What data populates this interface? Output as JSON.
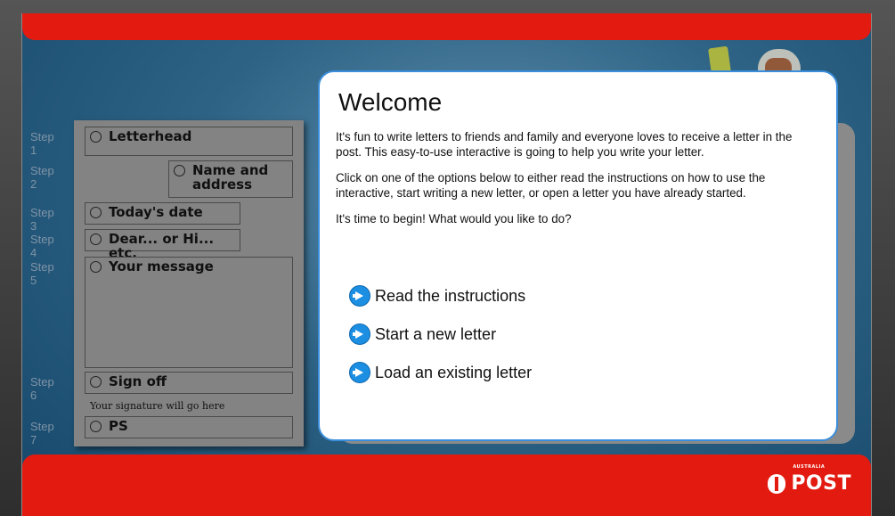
{
  "steps": [
    {
      "label": "Step 1",
      "field": "Letterhead"
    },
    {
      "label": "Step 2",
      "field_line1": "Name and",
      "field_line2": "address"
    },
    {
      "label": "Step 3",
      "field": "Today's date"
    },
    {
      "label": "Step 4",
      "field": "Dear... or Hi... etc."
    },
    {
      "label": "Step 5",
      "field": "Your message"
    },
    {
      "label": "Step 6",
      "field": "Sign off"
    },
    {
      "label": "Step 7",
      "field": "PS"
    }
  ],
  "signature_hint": "Your signature will go here",
  "modal": {
    "title": "Welcome",
    "paragraph1": "It's fun to write letters to friends and family and everyone loves to receive a letter in the post. This easy-to-use interactive is going to help you write your letter.",
    "paragraph2": "Click on one of the options below to either read the instructions on how to use the interactive, start writing a new letter, or open a letter you have already started.",
    "paragraph3": "It's time to begin! What would you like to do?",
    "options": [
      {
        "label": "Read the instructions",
        "icon": "arrow-right-icon"
      },
      {
        "label": "Start a new letter",
        "icon": "arrow-right-icon"
      },
      {
        "label": "Load an existing letter",
        "icon": "arrow-right-icon"
      }
    ]
  },
  "logo": {
    "small": "AUSTRALIA",
    "main": "POST"
  },
  "colors": {
    "brand_red": "#e31a0f",
    "accent_blue": "#1c8fe2",
    "modal_border": "#3a8edb"
  }
}
